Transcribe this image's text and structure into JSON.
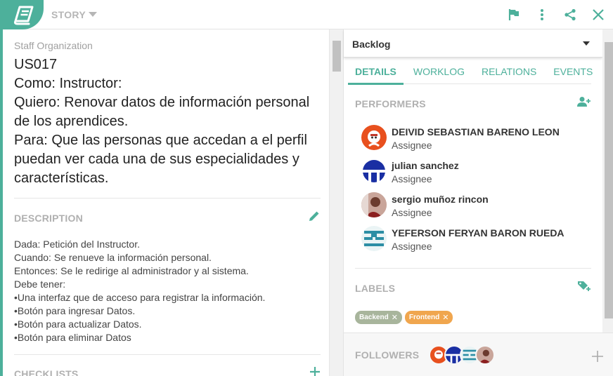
{
  "header": {
    "type_label": "STORY",
    "colors": {
      "accent": "#4db09b"
    },
    "icons": [
      "book-icon",
      "flag-icon",
      "more-vert-icon",
      "share-icon",
      "close-icon"
    ]
  },
  "story": {
    "project": "Staff Organization",
    "title": "US017\nComo: Instructor:\nQuiero: Renovar datos de información personal\nde los aprendices.\nPara: Que las personas que accedan a el perfil\npuedan ver cada una de sus especialidades y\ncaracterísticas."
  },
  "description": {
    "title": "DESCRIPTION",
    "text": "Dada: Petición del Instructor.\nCuando: Se renueve la información personal.\nEntonces: Se le redirige al administrador y al sistema.\nDebe tener:\n•Una interfaz que de acceso para registrar la información.\n•Botón para ingresar Datos.\n•Botón para actualizar Datos.\n•Botón para eliminar Datos"
  },
  "checklists": {
    "title": "CHECKLISTS"
  },
  "status": {
    "value": "Backlog"
  },
  "tabs": [
    {
      "label": "DETAILS",
      "active": true
    },
    {
      "label": "WORKLOG"
    },
    {
      "label": "RELATIONS"
    },
    {
      "label": "EVENTS"
    }
  ],
  "performers": {
    "title": "PERFORMERS",
    "people": [
      {
        "name": "DEIVID SEBASTIAN BARENO LEON",
        "role": "Assignee"
      },
      {
        "name": "julian sanchez",
        "role": "Assignee"
      },
      {
        "name": "sergio muñoz rincon",
        "role": "Assignee"
      },
      {
        "name": "YEFERSON FERYAN BARON RUEDA",
        "role": "Assignee"
      }
    ]
  },
  "labels": {
    "title": "LABELS",
    "items": [
      {
        "text": "Backend",
        "color": "#a8b59c"
      },
      {
        "text": "Frontend",
        "color": "#f0a64e"
      }
    ],
    "remove_glyph": "✕"
  },
  "followers": {
    "title": "FOLLOWERS"
  }
}
